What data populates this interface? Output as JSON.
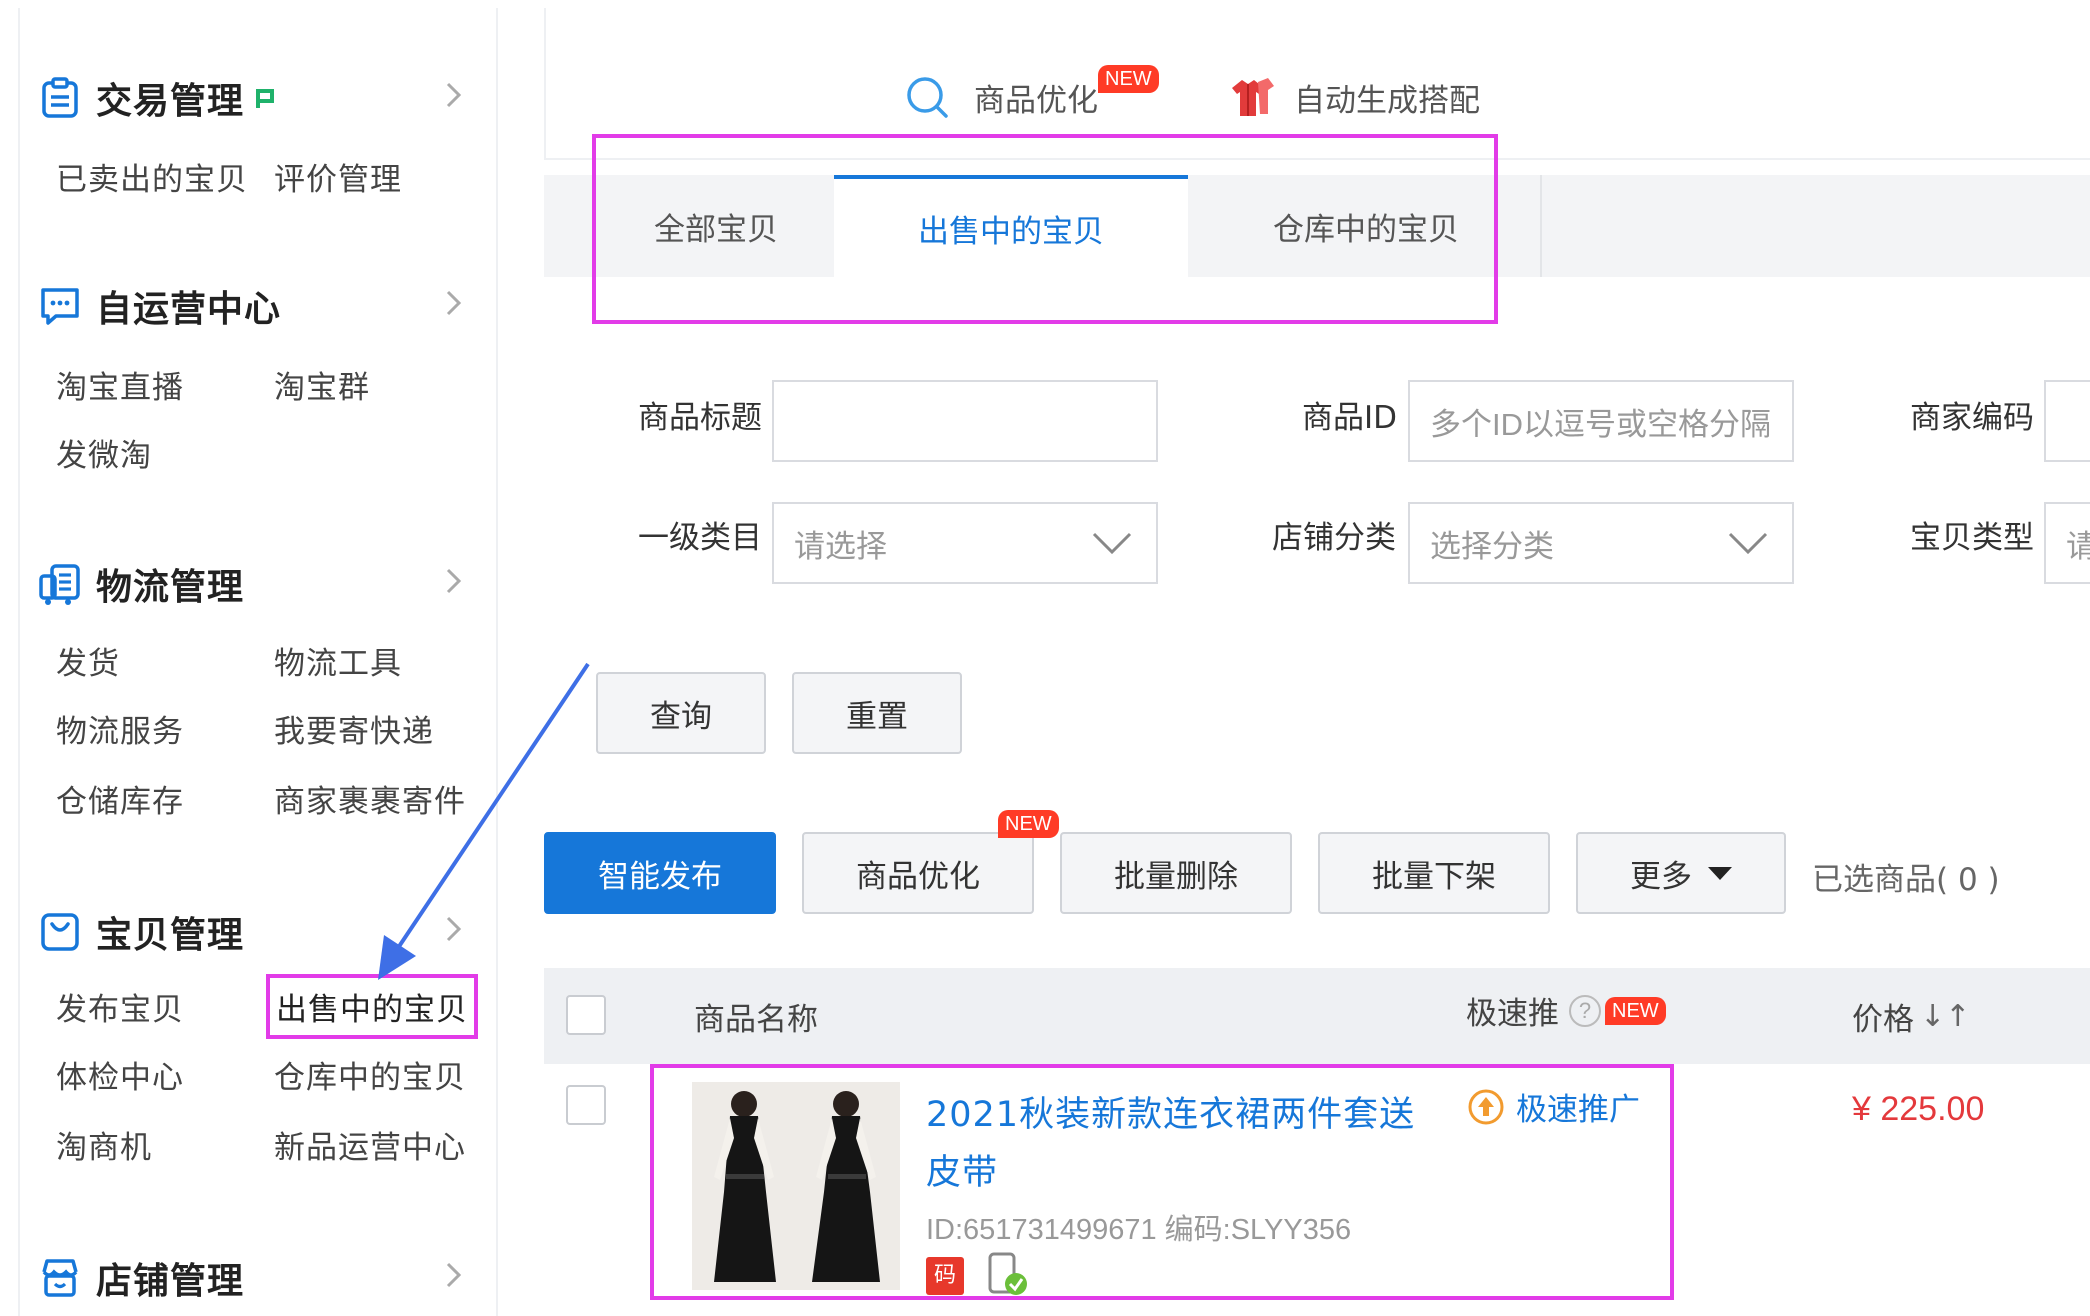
{
  "sidebar": {
    "sections": [
      {
        "title": "交易管理",
        "icon": "clipboard-icon",
        "items": [
          "已卖出的宝贝",
          "评价管理"
        ]
      },
      {
        "title": "自运营中心",
        "icon": "chat-icon",
        "items": [
          "淘宝直播",
          "淘宝群",
          "发微淘"
        ]
      },
      {
        "title": "物流管理",
        "icon": "delivery-icon",
        "items": [
          "发货",
          "物流工具",
          "物流服务",
          "我要寄快递",
          "仓储库存",
          "商家裹裹寄件"
        ]
      },
      {
        "title": "宝贝管理",
        "icon": "bag-icon",
        "items": [
          "发布宝贝",
          "出售中的宝贝",
          "体检中心",
          "仓库中的宝贝",
          "淘商机",
          "新品运营中心"
        ]
      },
      {
        "title": "店铺管理",
        "icon": "store-icon",
        "items": []
      }
    ]
  },
  "topbar": {
    "optimize_label": "商品优化",
    "new_badge": "NEW",
    "auto_match_label": "自动生成搭配"
  },
  "tabs": [
    "全部宝贝",
    "出售中的宝贝",
    "仓库中的宝贝"
  ],
  "filters": {
    "title_label": "商品标题",
    "title_value": "",
    "id_label": "商品ID",
    "id_placeholder": "多个ID以逗号或空格分隔",
    "code_label": "商家编码",
    "category_label": "一级类目",
    "category_placeholder": "请选择",
    "shop_cat_label": "店铺分类",
    "shop_cat_placeholder": "选择分类",
    "type_label": "宝贝类型",
    "type_placeholder": "请"
  },
  "buttons": {
    "query": "查询",
    "reset": "重置",
    "smart_publish": "智能发布",
    "optimize": "商品优化",
    "batch_delete": "批量删除",
    "batch_offshelf": "批量下架",
    "more": "更多",
    "selected": "已选商品( 0 )"
  },
  "table": {
    "col_name": "商品名称",
    "col_promo": "极速推",
    "col_help": "?",
    "col_price": "价格",
    "sort_glyph": "↓↑",
    "rows": [
      {
        "title": "2021秋装新款连衣裙两件套送皮带",
        "meta": "ID:651731499671 编码:SLYY356",
        "tag": "码",
        "promo": "极速推广",
        "price": "¥ 225.00"
      }
    ]
  },
  "colors": {
    "accent": "#1677d9",
    "highlight": "#e23be8",
    "price": "#e4393c",
    "badge": "#ff3b26"
  }
}
